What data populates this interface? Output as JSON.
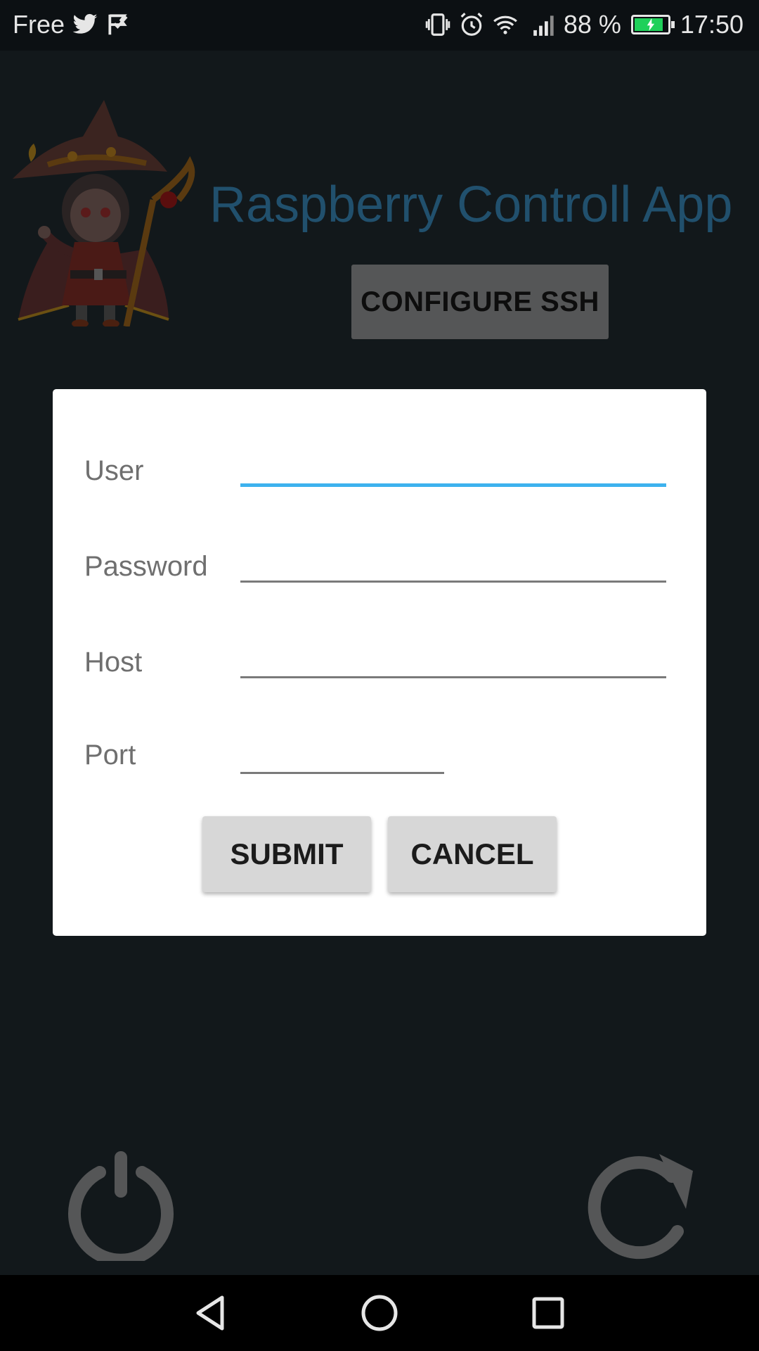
{
  "status_bar": {
    "carrier": "Free",
    "battery_text": "88 %",
    "battery_level": 0.88,
    "time": "17:50",
    "icons": [
      "twitter-icon",
      "flag-icon",
      "vibrate-icon",
      "alarm-icon",
      "wifi-icon",
      "signal-icon",
      "battery-icon"
    ]
  },
  "app": {
    "title": "Raspberry Controll App",
    "configure_button": "CONFIGURE SSH",
    "footer_icons": [
      "power-icon",
      "refresh-icon"
    ]
  },
  "dialog": {
    "fields": [
      {
        "label": "User",
        "value": "",
        "focused": true
      },
      {
        "label": "Password",
        "value": "",
        "focused": false
      },
      {
        "label": "Host",
        "value": "",
        "focused": false
      },
      {
        "label": "Port",
        "value": "",
        "focused": false
      }
    ],
    "submit_label": "SUBMIT",
    "cancel_label": "CANCEL"
  },
  "nav_bar": {
    "icons": [
      "back-icon",
      "home-icon",
      "recents-icon"
    ]
  },
  "colors": {
    "title": "#21506d",
    "focus_underline": "#3db2ee",
    "battery_fill": "#1fd05a"
  }
}
